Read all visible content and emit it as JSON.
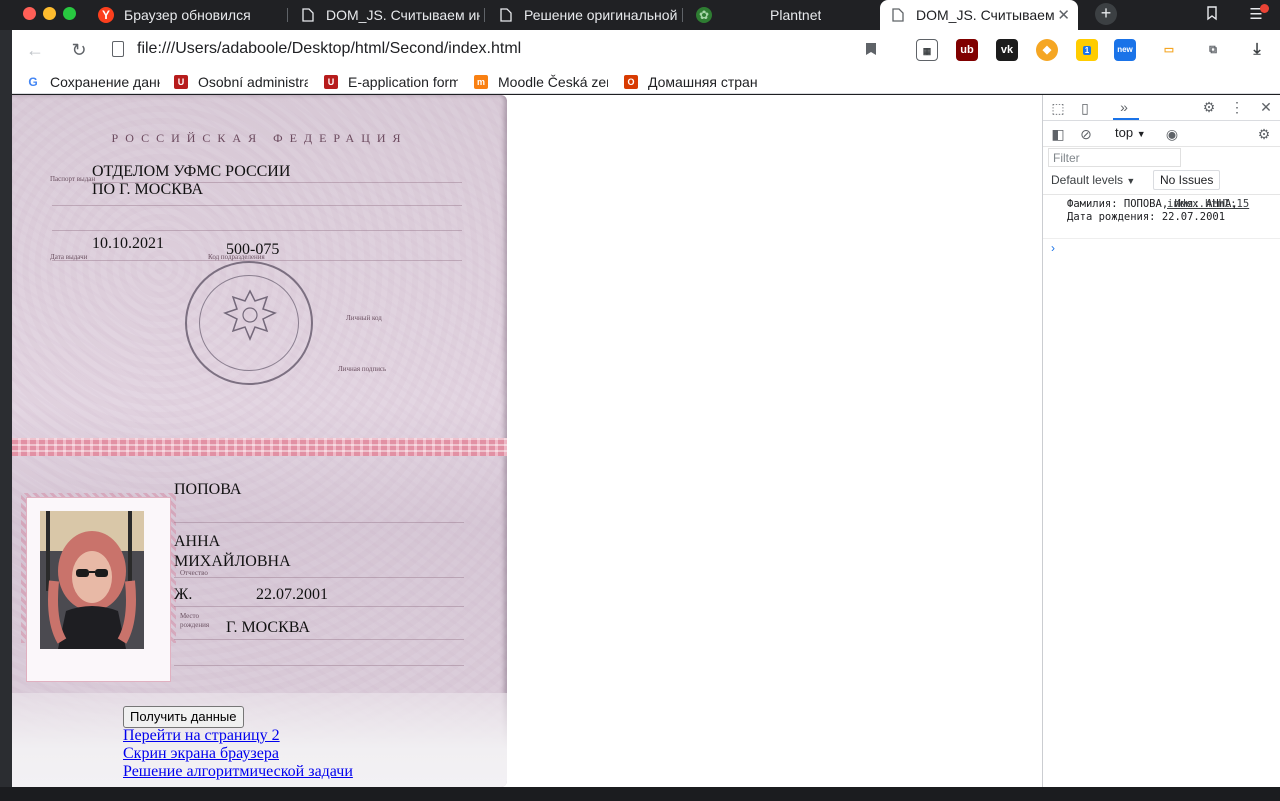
{
  "browser": {
    "tabs": [
      {
        "title": "Браузер обновился",
        "icon": "yandex-icon"
      },
      {
        "title": "DOM_JS. Считываем ин",
        "icon": "doc-icon"
      },
      {
        "title": "Решение оригинальной",
        "icon": "doc-icon"
      },
      {
        "title": "Plantnet",
        "icon": "leaf-icon"
      },
      {
        "title": "DOM_JS. Считываем",
        "icon": "doc-icon",
        "active": true
      }
    ],
    "address": "file:///Users/adaboole/Desktop/html/Second/index.html",
    "bookmarks": [
      {
        "title": "Сохранение данн",
        "icon": "google-icon"
      },
      {
        "title": "Osobní administra",
        "icon": "uis-icon"
      },
      {
        "title": "E-application form",
        "icon": "uis-icon"
      },
      {
        "title": "Moodle Česká zem",
        "icon": "moodle-icon"
      },
      {
        "title": "Домашняя стран",
        "icon": "office-icon"
      }
    ],
    "extension_badges": {
      "new": "new",
      "count": "1"
    }
  },
  "passport": {
    "header": "РОССИЙСКАЯ ФЕДЕРАЦИЯ",
    "issuer_line1": "ОТДЕЛОМ УФМС РОССИИ",
    "issuer_line2": "ПО Г. МОСКВА",
    "issue_date": "10.10.2021",
    "division_code": "500-075",
    "labels": {
      "issued_by": "Паспорт выдан",
      "issue_date": "Дата выдачи",
      "division_code": "Код подразделения",
      "personal_code": "Личный код",
      "signature": "Личная подпись",
      "patronymic": "Отчество",
      "birthplace": "Место рождения"
    },
    "surname": "ПОПОВА",
    "name": "АННА",
    "patronymic": "МИХАЙЛОВНА",
    "sex": "Ж.",
    "birth_date": "22.07.2001",
    "birthplace": "Г. МОСКВА"
  },
  "page": {
    "get_data_button": "Получить данные",
    "links": [
      "Перейти на страницу 2",
      "Скрин экрана браузера",
      "Решение алгоритмической задачи"
    ]
  },
  "devtools": {
    "context": "top",
    "filter_placeholder": "Filter",
    "levels": "Default levels",
    "issues": "No Issues",
    "log_message": "Фамилия: ПОПОВА, Имя: АННА, Дата рождения: 22.07.2001",
    "log_source": "index.html:15"
  },
  "colors": {
    "link": "#0000ee",
    "accent": "#1a73e8",
    "passport_stripe": "#e28a9e"
  }
}
